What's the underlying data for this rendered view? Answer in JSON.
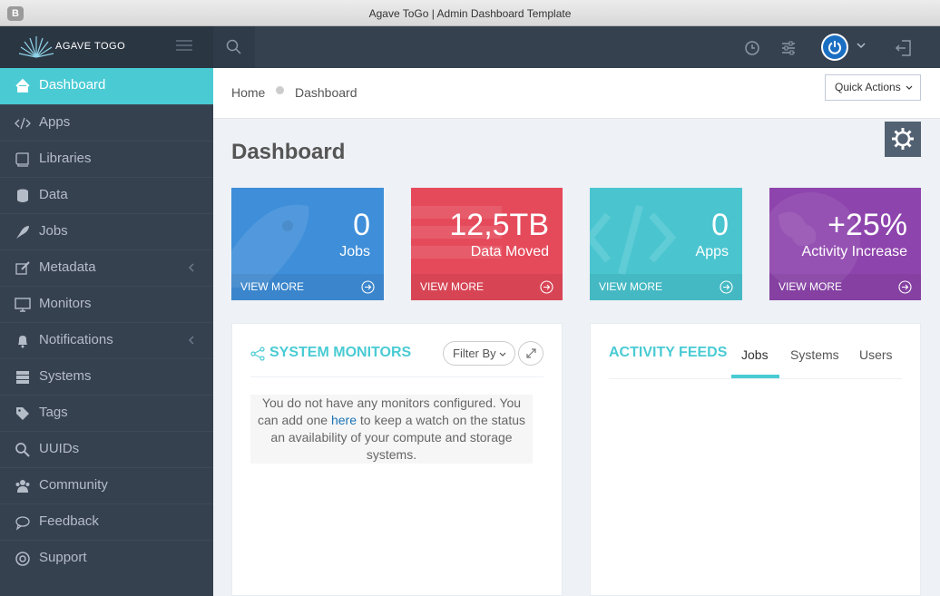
{
  "window": {
    "title": "Agave ToGo | Admin Dashboard Template",
    "badge": "B"
  },
  "header": {
    "logo_text": "AGAVE TOGO"
  },
  "sidebar": {
    "items": [
      {
        "label": "Dashboard",
        "icon": "home-icon",
        "active": true
      },
      {
        "label": "Apps",
        "icon": "code-icon"
      },
      {
        "label": "Libraries",
        "icon": "book-icon"
      },
      {
        "label": "Data",
        "icon": "database-icon"
      },
      {
        "label": "Jobs",
        "icon": "rocket-icon"
      },
      {
        "label": "Metadata",
        "icon": "edit-icon",
        "has_submenu": true
      },
      {
        "label": "Monitors",
        "icon": "monitor-icon"
      },
      {
        "label": "Notifications",
        "icon": "bell-icon",
        "has_submenu": true
      },
      {
        "label": "Systems",
        "icon": "server-icon"
      },
      {
        "label": "Tags",
        "icon": "tags-icon"
      },
      {
        "label": "UUIDs",
        "icon": "search-icon"
      },
      {
        "label": "Community",
        "icon": "users-icon"
      },
      {
        "label": "Feedback",
        "icon": "comment-icon"
      },
      {
        "label": "Support",
        "icon": "lifebuoy-icon"
      }
    ]
  },
  "breadcrumb": {
    "home": "Home",
    "current": "Dashboard"
  },
  "quick_actions": "Quick Actions",
  "page_title": "Dashboard",
  "tiles": [
    {
      "value": "0",
      "label": "Jobs",
      "more": "VIEW MORE",
      "color": "#3e8ed9"
    },
    {
      "value": "12,5TB",
      "label": "Data Moved",
      "more": "VIEW MORE",
      "color": "#e54a5b"
    },
    {
      "value": "0",
      "label": "Apps",
      "more": "VIEW MORE",
      "color": "#4ac5d0"
    },
    {
      "value": "+25%",
      "label": "Activity Increase",
      "more": "VIEW MORE",
      "color": "#8e44ad"
    }
  ],
  "monitors": {
    "title": "SYSTEM MONITORS",
    "filter": "Filter By",
    "notice_before": "You do not have any monitors configured. You can add one ",
    "notice_link": "here",
    "notice_after": " to keep a watch on the status an availability of your compute and storage systems."
  },
  "feeds": {
    "title": "ACTIVITY FEEDS",
    "tabs": [
      "Jobs",
      "Systems",
      "Users"
    ]
  },
  "colors": {
    "accent": "#4acbd4",
    "sidebar": "#364150",
    "header": "#364150"
  }
}
